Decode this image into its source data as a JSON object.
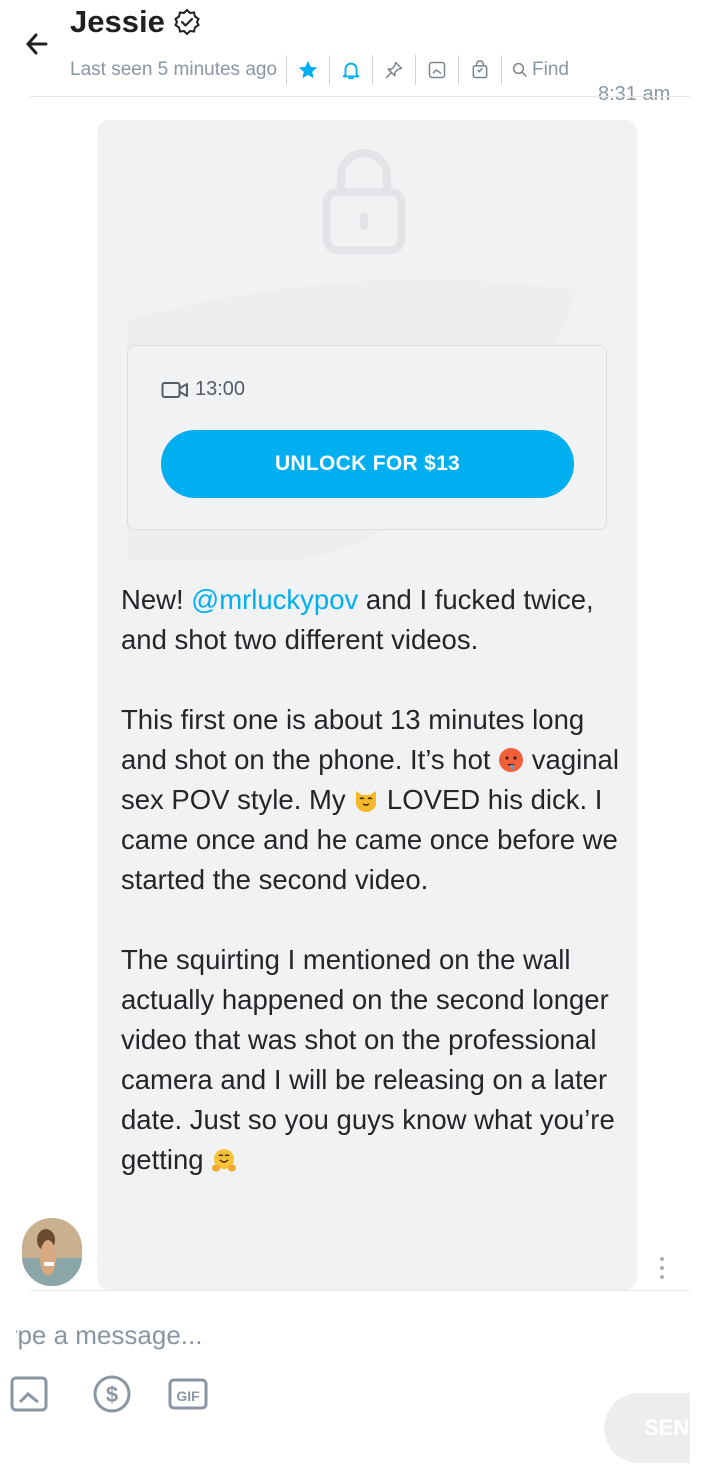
{
  "header": {
    "title": "Jessie",
    "status": "Last seen 5 minutes ago",
    "find_label": "Find",
    "time": "8:31 am"
  },
  "message": {
    "video_duration": "13:00",
    "unlock_label": "UNLOCK FOR $13",
    "paragraph1_start": "New! ",
    "mention": "@mrluckypov",
    "paragraph1_end": " and I fucked twice, and shot two different videos.",
    "paragraph2_a": "This first one is about 13 minutes long and shot on the phone. It’s hot ",
    "paragraph2_b": " vaginal sex POV style. My ",
    "paragraph2_c": " LOVED his dick. I came once and he came once before we started the second video.",
    "paragraph3": "The squirting I mentioned on the wall actually happened on the sec­ond longer video that was shot on the professional camera and I will be releasing on a later date. Just so you guys know what you’re getting ",
    "emojis": [
      "hot-face-emoji",
      "cat-face-emoji",
      "hugging-face-emoji"
    ]
  },
  "composer": {
    "placeholder": "Type a message...",
    "send_label": "SEND",
    "tools": [
      "image-icon",
      "dollar-icon",
      "gif-icon"
    ]
  },
  "colors": {
    "accent": "#00aff0",
    "muted": "#8a96a3",
    "bubble": "#f1f2f4"
  }
}
